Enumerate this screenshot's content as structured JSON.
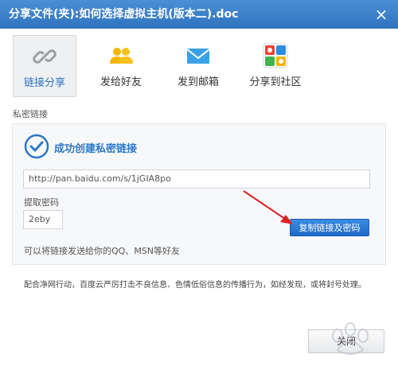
{
  "dialog": {
    "title": "分享文件(夹):如何选择虚拟主机(版本二).doc"
  },
  "tabs": [
    {
      "label": "链接分享",
      "icon": "link-icon",
      "active": true
    },
    {
      "label": "发给好友",
      "icon": "friends-icon",
      "active": false
    },
    {
      "label": "发到邮箱",
      "icon": "mail-icon",
      "active": false
    },
    {
      "label": "分享到社区",
      "icon": "community-icon",
      "active": false
    }
  ],
  "private_link": {
    "section_label": "私密链接",
    "success_title": "成功创建私密链接",
    "url": "http://pan.baidu.com/s/1jGIA8po",
    "password_label": "提取密码",
    "password": "2eby",
    "copy_button": "复制链接及密码",
    "hint": "可以将链接发送给你的QQ、MSN等好友"
  },
  "notice": "配合净网行动，百度云严厉打击不良信息、色情低俗信息的传播行为，如经发现，或将封号处理。",
  "footer": {
    "close_button": "关闭"
  },
  "colors": {
    "title_bar": "#3a80cc",
    "accent": "#2a78c8",
    "primary_button": "#2a7ad6",
    "annotation_arrow": "#e02020"
  }
}
